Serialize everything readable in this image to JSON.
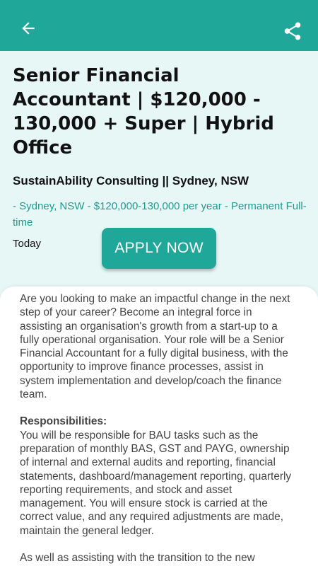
{
  "colors": {
    "accent": "#1fa79a",
    "background": "#e7f7f6",
    "meta_text": "#1f9b90"
  },
  "appbar": {
    "back_icon": "arrow-left-icon",
    "share_icon": "share-icon"
  },
  "job": {
    "title": "Senior Financial Accountant | $120,000 - 130,000 + Super | Hybrid Office",
    "company_location": "SustainAbility Consulting || Sydney, NSW",
    "meta": " - Sydney, NSW - $120,000-130,000 per year - Permanent Full-time",
    "posted": "Today",
    "apply_label": "APPLY NOW"
  },
  "description": {
    "intro": "Are you looking to make an impactful change in the next step of your career? Become an integral force in assisting an organisation's growth from a start-up to a fully operational organisation. Your role will be a Senior Financial Accountant for a fully digital business, with the opportunity to improve finance processes, assist in system implementation and develop/coach the finance team.",
    "responsibilities_heading": "Responsibilities:",
    "responsibilities_text": "You will be responsible for BAU tasks such as the preparation of monthly BAS, GST and PAYG, ownership of internal and external audits and reporting, financial statements, dashboard/management reporting, quarterly reporting requirements, and stock and asset management. You will ensure stock is carried at the correct value, and any required adjustments are made, maintain the general ledger.",
    "next_text": "As well as assisting with the transition to the new"
  }
}
